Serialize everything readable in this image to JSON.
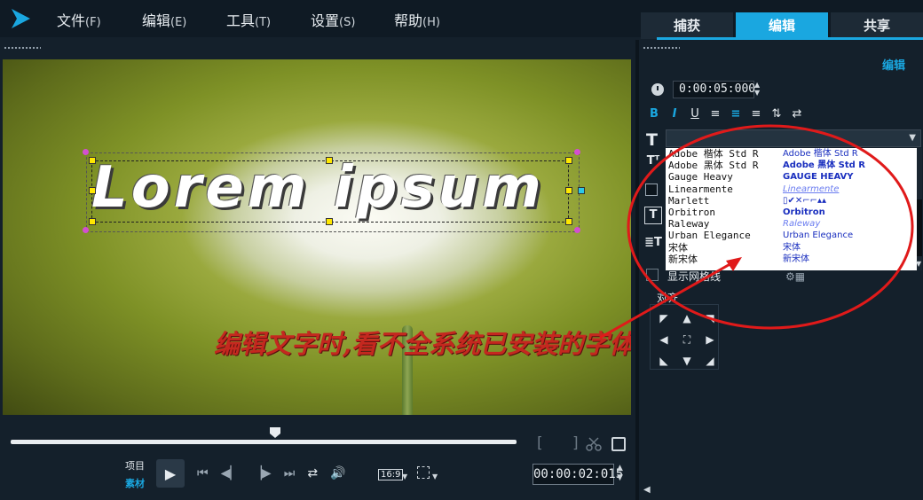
{
  "menubar": {
    "items": [
      {
        "label": "文件",
        "accel": "(F)"
      },
      {
        "label": "编辑",
        "accel": "(E)"
      },
      {
        "label": "工具",
        "accel": "(T)"
      },
      {
        "label": "设置",
        "accel": "(S)"
      },
      {
        "label": "帮助",
        "accel": "(H)"
      }
    ],
    "tabs": [
      "捕获",
      "编辑",
      "共享"
    ],
    "active_tab": "编辑"
  },
  "preview": {
    "title_text": "Lorem ipsum",
    "annotation": "编辑文字时,看不全系统已安装的字体"
  },
  "player": {
    "label_project": "项目",
    "label_clip": "素材",
    "aspect": "16:9",
    "timecode": "00:00:02:015"
  },
  "options": {
    "title": "编辑",
    "duration": "0:00:05:000",
    "format_buttons": [
      "B",
      "I",
      "U",
      "≡",
      "≡",
      "≡",
      "⇅",
      "⇄"
    ],
    "fonts": [
      {
        "name": "Adobe 楷体 Std R",
        "sample": "Adobe 楷体 Std R",
        "style": "normal"
      },
      {
        "name": "Adobe 黑体 Std R",
        "sample": "Adobe 黑体 Std R",
        "style": "bold"
      },
      {
        "name": "Gauge Heavy",
        "sample": "GAUGE HEAVY",
        "style": "bold"
      },
      {
        "name": "Linearmente",
        "sample": "Linearmente",
        "style": "light"
      },
      {
        "name": "Marlett",
        "sample": "▯✔✕⌐⌐▴▴",
        "style": "normal"
      },
      {
        "name": "Orbitron",
        "sample": "Orbitron",
        "style": "bold"
      },
      {
        "name": "Raleway",
        "sample": "Raleway",
        "style": "light"
      },
      {
        "name": "Urban Elegance",
        "sample": "Urban Elegance",
        "style": "normal"
      },
      {
        "name": "宋体",
        "sample": "宋体",
        "style": "normal"
      },
      {
        "name": "新宋体",
        "sample": "新宋体",
        "style": "normal"
      }
    ],
    "grid_label": "显示网格线",
    "align_label": "对齐"
  },
  "colors": {
    "accent": "#1aa7e0",
    "annotation_red": "#e01a1a",
    "background": "#14202b"
  },
  "icons": [
    "logo-icon",
    "clock-icon",
    "text-icon",
    "scissors-icon",
    "copy-icon",
    "play-icon",
    "volume-icon",
    "repeat-icon",
    "gear-icon"
  ]
}
